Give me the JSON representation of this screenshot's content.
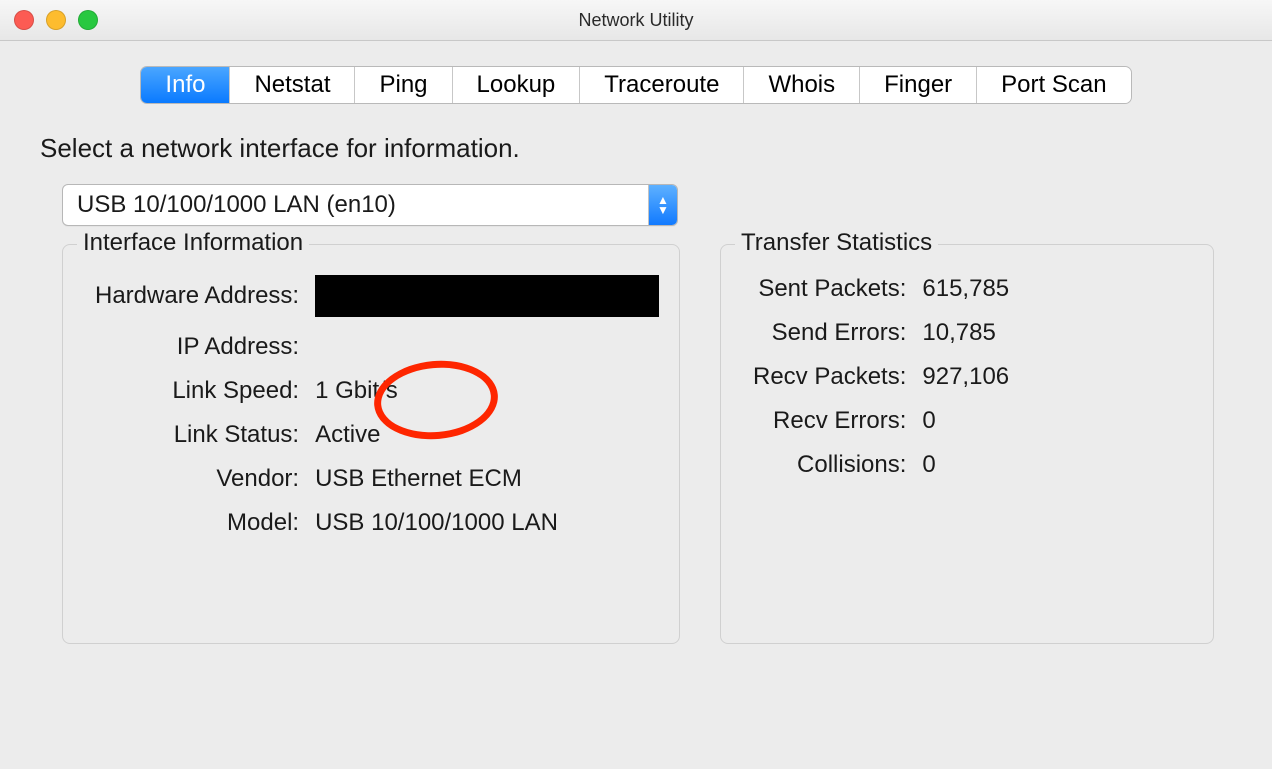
{
  "window": {
    "title": "Network Utility"
  },
  "tabs": [
    {
      "label": "Info",
      "active": true
    },
    {
      "label": "Netstat",
      "active": false
    },
    {
      "label": "Ping",
      "active": false
    },
    {
      "label": "Lookup",
      "active": false
    },
    {
      "label": "Traceroute",
      "active": false
    },
    {
      "label": "Whois",
      "active": false
    },
    {
      "label": "Finger",
      "active": false
    },
    {
      "label": "Port Scan",
      "active": false
    }
  ],
  "instruction": "Select a network interface for information.",
  "interface_select": {
    "value": "USB 10/100/1000 LAN (en10)"
  },
  "interface_info": {
    "title": "Interface Information",
    "labels": {
      "hardware_address": "Hardware Address:",
      "ip_address": "IP Address:",
      "link_speed": "Link Speed:",
      "link_status": "Link Status:",
      "vendor": "Vendor:",
      "model": "Model:"
    },
    "values": {
      "hardware_address": "",
      "hardware_address_redacted": true,
      "ip_address": "",
      "link_speed": "1 Gbit/s",
      "link_status": "Active",
      "vendor": "USB Ethernet ECM",
      "model": "USB 10/100/1000 LAN"
    }
  },
  "transfer_stats": {
    "title": "Transfer Statistics",
    "labels": {
      "sent_packets": "Sent Packets:",
      "send_errors": "Send Errors:",
      "recv_packets": "Recv Packets:",
      "recv_errors": "Recv Errors:",
      "collisions": "Collisions:"
    },
    "values": {
      "sent_packets": "615,785",
      "send_errors": "10,785",
      "recv_packets": "927,106",
      "recv_errors": "0",
      "collisions": "0"
    }
  },
  "annotation": {
    "circled_field": "link_speed"
  }
}
